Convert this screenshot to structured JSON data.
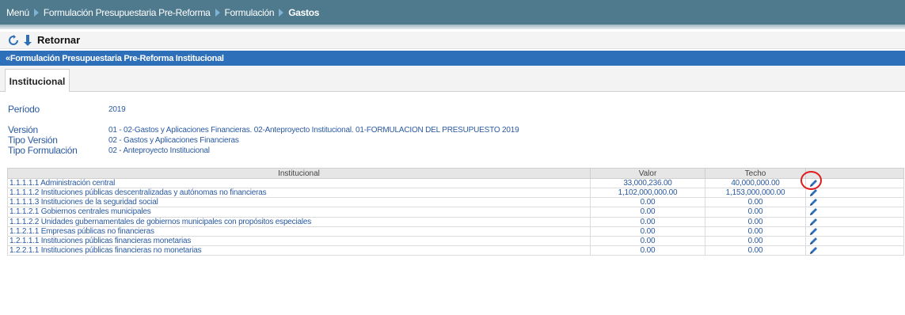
{
  "breadcrumb": {
    "items": [
      {
        "label": "Menú"
      },
      {
        "label": "Formulación Presupuestaria Pre-Reforma"
      },
      {
        "label": "Formulación"
      },
      {
        "label": "Gastos"
      }
    ]
  },
  "actions": {
    "back_label": "Retornar"
  },
  "section": {
    "title": "«Formulación Presupuestaria Pre-Reforma Institucional"
  },
  "tabs": [
    {
      "label": "Institucional",
      "active": true
    }
  ],
  "fields": {
    "periodo": {
      "label": "Período",
      "value": "2019"
    },
    "version": {
      "label": "Versión",
      "value": "01 - 02-Gastos y Aplicaciones Financieras. 02-Anteproyecto Institucional. 01-FORMULACION DEL PRESUPUESTO 2019"
    },
    "tipo_version": {
      "label": "Tipo Versión",
      "value": "02 - Gastos y Aplicaciones Financieras"
    },
    "tipo_formulacion": {
      "label": "Tipo Formulación",
      "value": "02 - Anteproyecto Institucional"
    }
  },
  "table": {
    "columns": [
      "Institucional",
      "Valor",
      "Techo",
      ""
    ],
    "rows": [
      {
        "institucional": "1.1.1.1.1 Administración central",
        "valor": "33,000,236.00",
        "techo": "40,000,000.00"
      },
      {
        "institucional": "1.1.1.1.2 Instituciones públicas descentralizadas y autónomas no financieras",
        "valor": "1,102,000,000.00",
        "techo": "1,153,000,000.00"
      },
      {
        "institucional": "1.1.1.1.3 Instituciones de la seguridad social",
        "valor": "0.00",
        "techo": "0.00"
      },
      {
        "institucional": "1.1.1.2.1 Gobiernos centrales municipales",
        "valor": "0.00",
        "techo": "0.00"
      },
      {
        "institucional": "1.1.1.2.2 Unidades gubernamentales de gobiernos municipales con propósitos especiales",
        "valor": "0.00",
        "techo": "0.00"
      },
      {
        "institucional": "1.1.2.1.1 Empresas públicas no financieras",
        "valor": "0.00",
        "techo": "0.00"
      },
      {
        "institucional": "1.2.1.1.1 Instituciones públicas financieras monetarias",
        "valor": "0.00",
        "techo": "0.00"
      },
      {
        "institucional": "1.2.2.1.1 Instituciones públicas financieras no monetarias",
        "valor": "0.00",
        "techo": "0.00"
      }
    ]
  },
  "colors": {
    "topbar": "#4f7a8d",
    "section_header": "#2d6fb8",
    "link_text": "#2a5aa0",
    "highlight": "#e01b1b"
  }
}
